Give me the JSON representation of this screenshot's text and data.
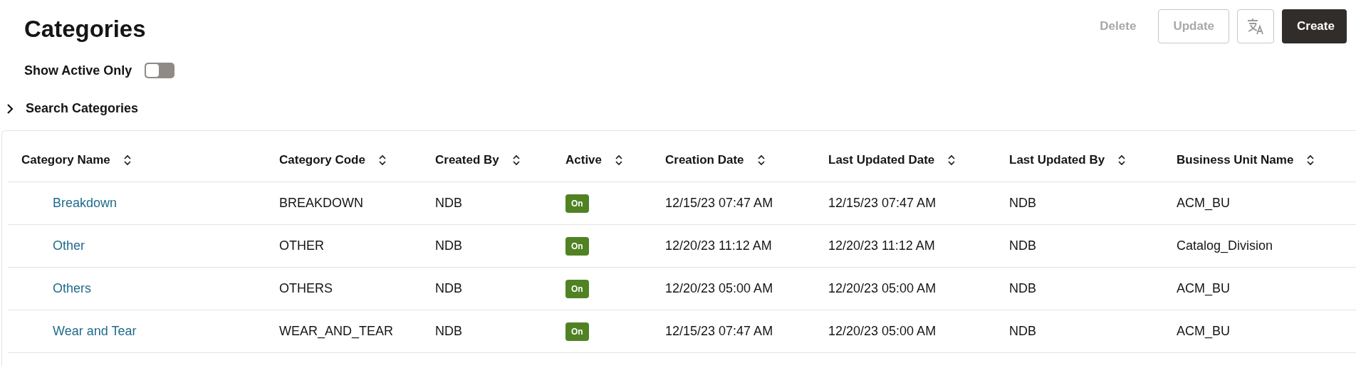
{
  "title": "Categories",
  "toolbar": [
    {
      "kind": "text",
      "label": "Delete",
      "disabled": true
    },
    {
      "kind": "outline",
      "label": "Update",
      "disabled": true
    },
    {
      "kind": "icon"
    },
    {
      "kind": "primary",
      "label": "Create",
      "disabled": false
    }
  ],
  "filter": {
    "label": "Show Active Only",
    "on": false
  },
  "search": {
    "label": "Search Categories",
    "expanded": false
  },
  "table": {
    "columns": [
      "Category Name",
      "Category Code",
      "Created By",
      "Active",
      "Creation Date",
      "Last Updated Date",
      "Last Updated By",
      "Business Unit Name"
    ],
    "rows": [
      {
        "name": "Breakdown",
        "code": "BREAKDOWN",
        "created_by": "NDB",
        "active": "On",
        "creation_date": "12/15/23 07:47 AM",
        "last_updated_date": "12/15/23 07:47 AM",
        "last_updated_by": "NDB",
        "business_unit": "ACM_BU"
      },
      {
        "name": "Other",
        "code": "OTHER",
        "created_by": "NDB",
        "active": "On",
        "creation_date": "12/20/23 11:12 AM",
        "last_updated_date": "12/20/23 11:12 AM",
        "last_updated_by": "NDB",
        "business_unit": "Catalog_Division"
      },
      {
        "name": "Others",
        "code": "OTHERS",
        "created_by": "NDB",
        "active": "On",
        "creation_date": "12/20/23 05:00 AM",
        "last_updated_date": "12/20/23 05:00 AM",
        "last_updated_by": "NDB",
        "business_unit": "ACM_BU"
      },
      {
        "name": "Wear and Tear",
        "code": "WEAR_AND_TEAR",
        "created_by": "NDB",
        "active": "On",
        "creation_date": "12/15/23 07:47 AM",
        "last_updated_date": "12/20/23 05:00 AM",
        "last_updated_by": "NDB",
        "business_unit": "ACM_BU"
      }
    ]
  }
}
